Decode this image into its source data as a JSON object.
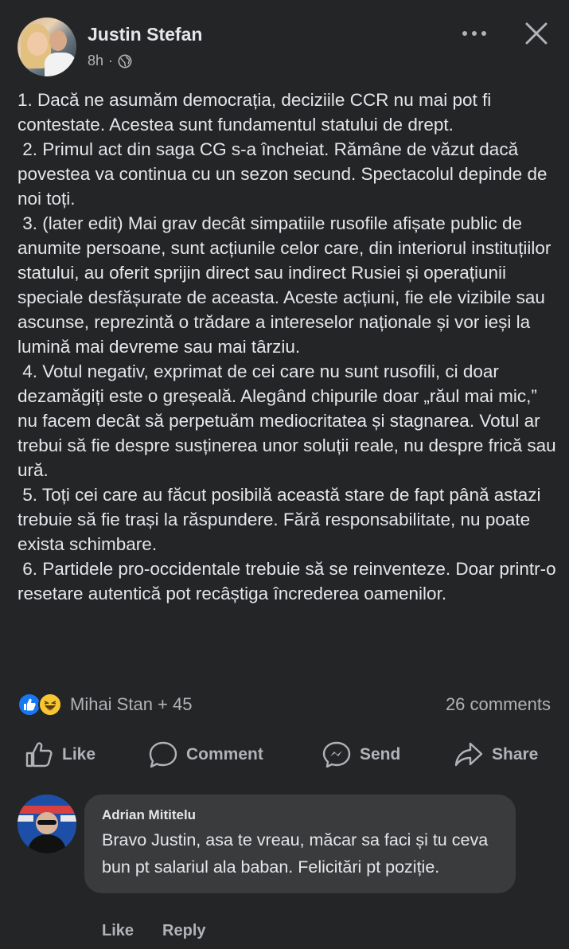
{
  "post": {
    "author": "Justin Stefan",
    "time": "8h",
    "separator": "·",
    "privacy_icon": "globe-icon",
    "paragraphs": [
      "1. Dacă ne asumăm democrația, deciziile CCR nu mai pot fi contestate. Acestea sunt fundamentul statului de drept.",
      " 2. Primul act din saga CG s-a încheiat. Rămâne de văzut dacă povestea va continua cu un sezon secund. Spectacolul depinde de noi toți.",
      " 3. (later edit) Mai grav decât simpatiile rusofile afișate public de anumite persoane, sunt acțiunile celor care, din interiorul instituțiilor statului, au oferit sprijin direct sau indirect Rusiei și operațiunii speciale desfășurate de aceasta. Aceste acțiuni, fie ele vizibile sau ascunse, reprezintă o trădare a intereselor naționale și vor ieși la lumină mai devreme sau mai târziu.",
      " 4. Votul negativ, exprimat de cei care nu sunt rusofili, ci doar dezamăgiți este o greșeală. Alegând chipurile doar „răul mai mic,” nu facem decât să perpetuăm mediocritatea și stagnarea. Votul ar trebui să fie despre susținerea unor soluții reale, nu despre frică sau ură.",
      " 5. Toți cei care au făcut posibilă această stare de fapt până astazi trebuie să fie trași la răspundere. Fără responsabilitate, nu poate exista schimbare.",
      " 6. Partidele pro-occidentale trebuie să se reinventeze. Doar printr-o resetare autentică pot recâștiga încrederea oamenilor."
    ]
  },
  "stats": {
    "reactions_label": "Mihai Stan + 45",
    "comments_label": "26 comments",
    "reaction_icons": [
      "like-reaction-icon",
      "haha-reaction-icon"
    ]
  },
  "actions": {
    "like": "Like",
    "comment": "Comment",
    "send": "Send",
    "share": "Share"
  },
  "comment": {
    "author": "Adrian Mititelu",
    "text": "Bravo Justin, asa te vreau, măcar sa faci și tu ceva bun pt salariul ala baban. Felicitări pt poziție.",
    "like": "Like",
    "reply": "Reply"
  },
  "colors": {
    "background": "#242526",
    "bubble": "#3a3b3c",
    "text": "#e4e6eb",
    "secondary": "#b0b3b8",
    "like_blue": "#1877f2"
  }
}
